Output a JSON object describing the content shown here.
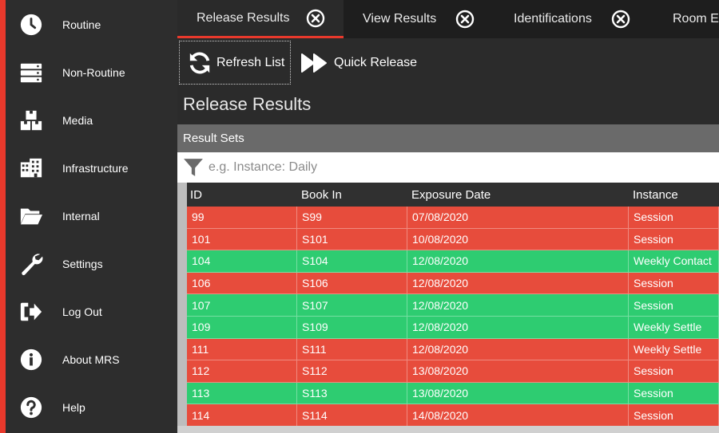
{
  "sidebar": {
    "items": [
      {
        "label": "Routine",
        "icon": "clock-icon"
      },
      {
        "label": "Non-Routine",
        "icon": "server-icon"
      },
      {
        "label": "Media",
        "icon": "boxes-icon"
      },
      {
        "label": "Infrastructure",
        "icon": "building-icon"
      },
      {
        "label": "Internal",
        "icon": "folder-open-icon"
      },
      {
        "label": "Settings",
        "icon": "wrench-icon"
      },
      {
        "label": "Log Out",
        "icon": "sign-out-icon"
      },
      {
        "label": "About MRS",
        "icon": "info-icon"
      },
      {
        "label": "Help",
        "icon": "question-icon"
      }
    ]
  },
  "tabs": [
    {
      "label": "Release Results",
      "active": true
    },
    {
      "label": "View Results",
      "active": false
    },
    {
      "label": "Identifications",
      "active": false
    },
    {
      "label": "Room Ec",
      "active": false
    }
  ],
  "toolbar": {
    "refresh_label": "Refresh List",
    "quick_release_label": "Quick Release"
  },
  "page_title": "Release Results",
  "section_header": "Result Sets",
  "filter": {
    "value": "",
    "placeholder": "e.g. Instance: Daily"
  },
  "table": {
    "columns": [
      "ID",
      "Book In",
      "Exposure Date",
      "Instance"
    ],
    "rows": [
      {
        "id": "99",
        "book_in": "S99",
        "exposure_date": "07/08/2020",
        "instance": "Session",
        "status": "red"
      },
      {
        "id": "101",
        "book_in": "S101",
        "exposure_date": "10/08/2020",
        "instance": "Session",
        "status": "red"
      },
      {
        "id": "104",
        "book_in": "S104",
        "exposure_date": "12/08/2020",
        "instance": "Weekly Contact",
        "status": "green"
      },
      {
        "id": "106",
        "book_in": "S106",
        "exposure_date": "12/08/2020",
        "instance": "Session",
        "status": "red"
      },
      {
        "id": "107",
        "book_in": "S107",
        "exposure_date": "12/08/2020",
        "instance": "Session",
        "status": "green"
      },
      {
        "id": "109",
        "book_in": "S109",
        "exposure_date": "12/08/2020",
        "instance": "Weekly Settle",
        "status": "green"
      },
      {
        "id": "111",
        "book_in": "S111",
        "exposure_date": "12/08/2020",
        "instance": "Weekly Settle",
        "status": "red"
      },
      {
        "id": "112",
        "book_in": "S112",
        "exposure_date": "13/08/2020",
        "instance": "Session",
        "status": "red"
      },
      {
        "id": "113",
        "book_in": "S113",
        "exposure_date": "13/08/2020",
        "instance": "Session",
        "status": "green"
      },
      {
        "id": "114",
        "book_in": "S114",
        "exposure_date": "14/08/2020",
        "instance": "Session",
        "status": "red"
      }
    ]
  },
  "colors": {
    "accent": "#e8392c",
    "row_red": "#e74c3c",
    "row_green": "#2ecc71"
  }
}
